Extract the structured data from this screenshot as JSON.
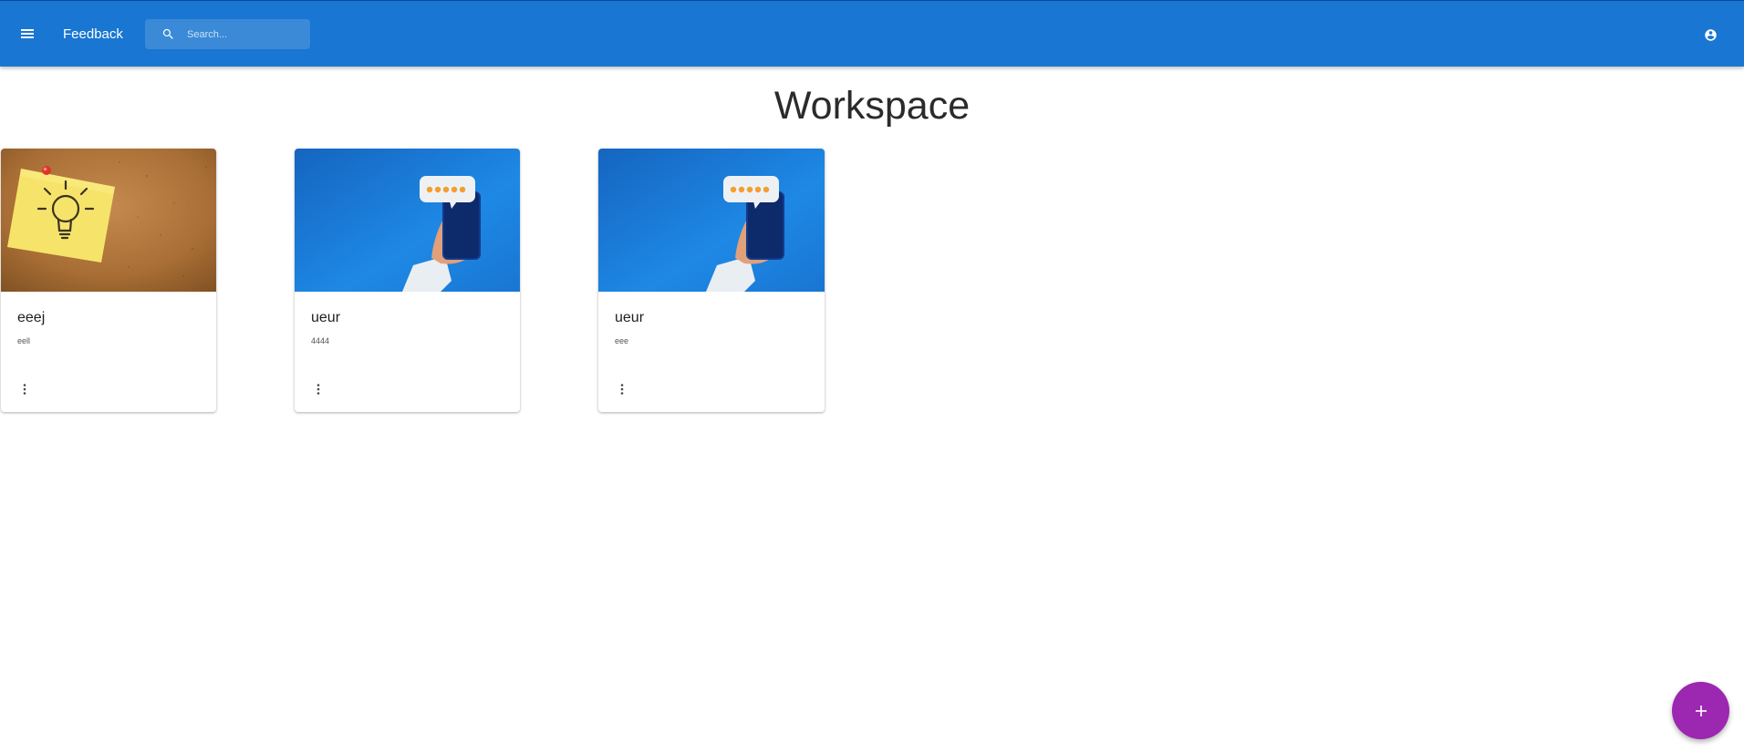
{
  "appbar": {
    "title": "Feedback",
    "menu_icon": "menu-icon",
    "account_icon": "account-circle-icon"
  },
  "search": {
    "placeholder": "Search...",
    "value": "",
    "icon": "search-icon"
  },
  "page": {
    "title": "Workspace"
  },
  "cards": [
    {
      "title": "eeej",
      "subtitle": "eell",
      "image": "lightbulb-sticky-note-image",
      "more_icon": "more-vert-icon"
    },
    {
      "title": "ueur",
      "subtitle": "4444",
      "image": "phone-rating-image",
      "more_icon": "more-vert-icon"
    },
    {
      "title": "ueur",
      "subtitle": "eee",
      "image": "phone-rating-image",
      "more_icon": "more-vert-icon"
    }
  ],
  "fab": {
    "label": "+",
    "icon": "add-icon"
  },
  "colors": {
    "appbar": "#1976d2",
    "fab": "#9c27b0",
    "background": "#ffffff"
  }
}
